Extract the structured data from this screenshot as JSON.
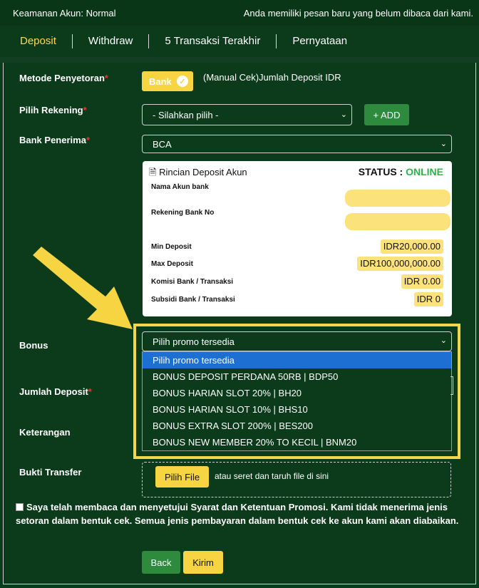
{
  "topbar": {
    "security": "Keamanan Akun: Normal",
    "message": "Anda memiliki pesan baru yang belum dibaca dari kami."
  },
  "tabs": [
    "Deposit",
    "Withdraw",
    "5 Transaksi Terakhir",
    "Pernyataan"
  ],
  "form": {
    "method_label": "Metode Penyetoran",
    "bank_button": "Bank",
    "method_desc": "(Manual Cek)Jumlah Deposit IDR",
    "account_label": "Pilih Rekening",
    "account_select": "- Silahkan pilih -",
    "add_button": "+ ADD",
    "receiver_label": "Bank Penerima",
    "receiver_select": "BCA",
    "bonus_label": "Bonus",
    "bonus_select": "Pilih promo tersedia",
    "amount_label": "Jumlah Deposit",
    "note_label": "Keterangan",
    "proof_label": "Bukti Transfer",
    "file_button": "Pilih File",
    "file_hint": "atau seret dan taruh file di sini",
    "agree_text": "Saya telah membaca dan menyetujui Syarat dan Ketentuan Promosi. Kami tidak menerima jenis setoran dalam bentuk cek. Semua jenis pembayaran dalam bentuk cek ke akun kami akan diabaikan.",
    "back_button": "Back",
    "send_button": "Kirim"
  },
  "card": {
    "title": "Rincian Deposit Akun",
    "status_prefix": "STATUS : ",
    "status_value": "ONLINE",
    "rows": {
      "account_name": "Nama Akun bank",
      "account_no": "Rekening Bank No",
      "min_label": "Min Deposit",
      "min_value": "IDR20,000.00",
      "max_label": "Max Deposit",
      "max_value": "IDR100,000,000.00",
      "fee_label": "Komisi Bank / Transaksi",
      "fee_value": "IDR 0.00",
      "subsidy_label": "Subsidi Bank / Transaksi",
      "subsidy_value": "IDR 0"
    }
  },
  "bonus_options": [
    "Pilih promo tersedia",
    "BONUS DEPOSIT PERDANA 50RB | BDP50",
    "BONUS HARIAN SLOT 20% | BH20",
    "BONUS HARIAN SLOT 10% | BHS10",
    "BONUS EXTRA SLOT 200% | BES200",
    "BONUS NEW MEMBER 20% TO KECIL | BNM20"
  ],
  "colors": {
    "background": "#0b3b1b",
    "accent_yellow": "#f6d442",
    "green_button": "#2e8a3d",
    "online": "#27b64a",
    "selected_option": "#1d6fd2"
  }
}
